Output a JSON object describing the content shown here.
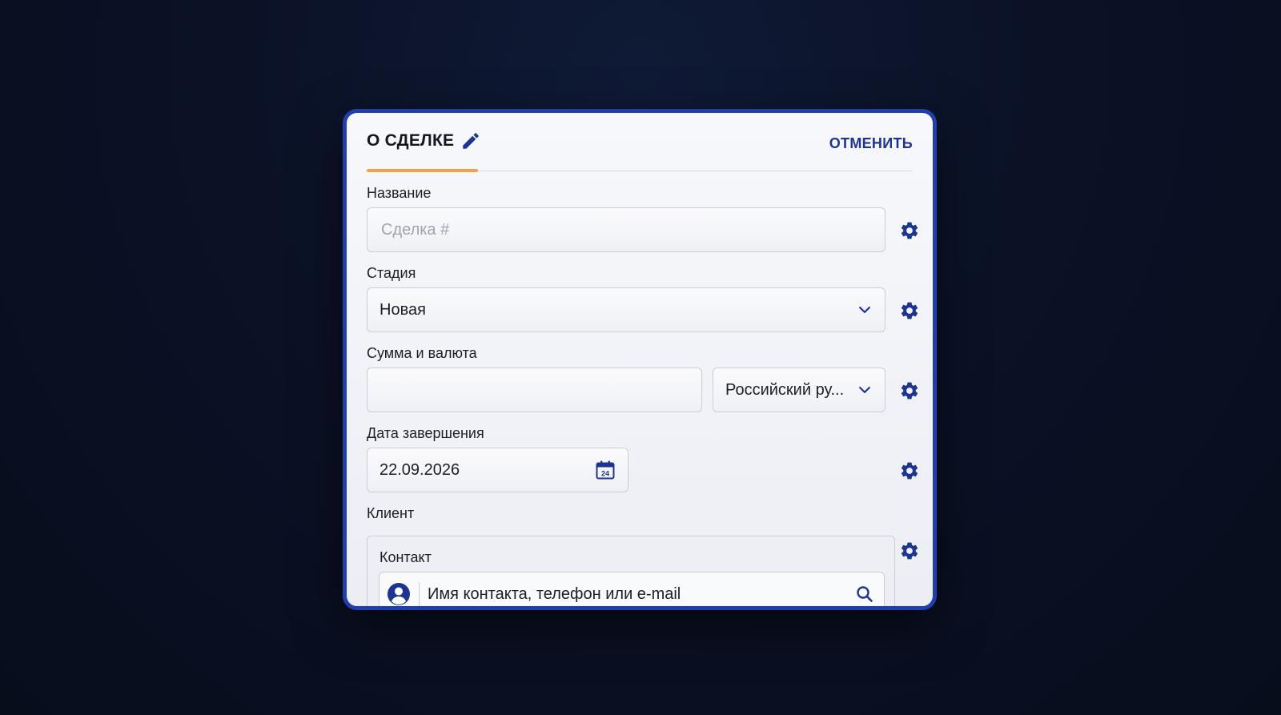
{
  "header": {
    "title": "О СДЕЛКЕ",
    "cancel_label": "ОТМЕНИТЬ"
  },
  "fields": {
    "name": {
      "label": "Название",
      "value": "",
      "placeholder": "Сделка #"
    },
    "stage": {
      "label": "Стадия",
      "selected": "Новая"
    },
    "amount": {
      "label": "Сумма и валюта",
      "value": "",
      "currency_selected": "Российский ру..."
    },
    "close_date": {
      "label": "Дата завершения",
      "value": "22.09.2026",
      "calendar_day": "24"
    },
    "client": {
      "label": "Клиент",
      "contact_label": "Контакт",
      "contact_text": "Имя контакта, телефон или e-mail"
    }
  },
  "icons": {
    "edit": "pencil-icon",
    "settings": "gear-icon",
    "dropdown": "chevron-down-icon",
    "calendar": "calendar-icon",
    "contact": "user-avatar-icon",
    "search": "search-icon"
  },
  "colors": {
    "accent": "#1d3592",
    "card_border": "#1f3fb0",
    "tab_underline": "#f0a14a",
    "background": "#0b1226"
  }
}
